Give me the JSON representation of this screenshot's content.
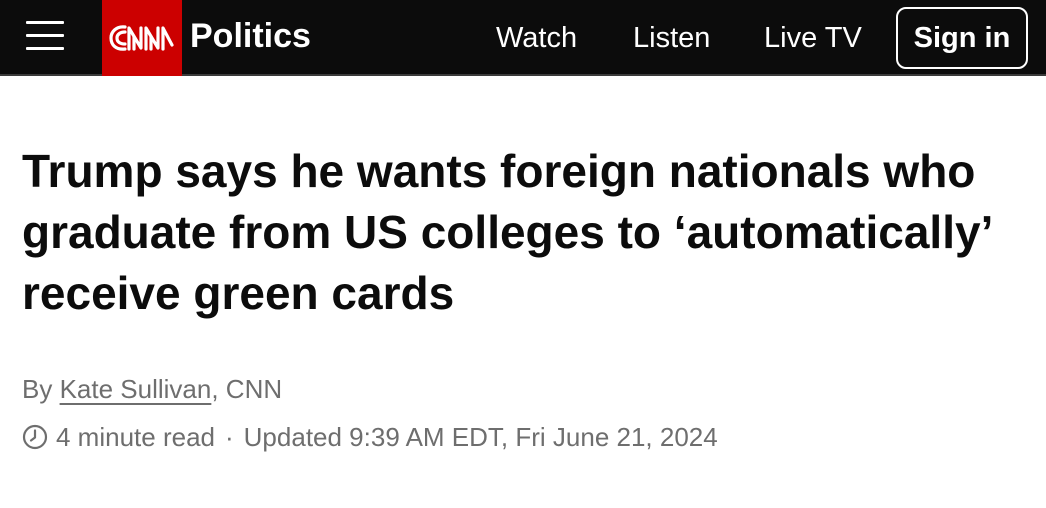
{
  "header": {
    "brand": "CNN",
    "section": "Politics",
    "nav": [
      "Watch",
      "Listen",
      "Live TV"
    ],
    "signin_label": "Sign in",
    "icons": {
      "menu": "hamburger-menu-icon",
      "logo": "cnn-logo"
    },
    "colors": {
      "bar": "#0c0c0c",
      "brand_red": "#cc0000"
    }
  },
  "article": {
    "headline": "Trump says he wants foreign nationals who graduate from US colleges to ‘automatically’ receive green cards",
    "byline_prefix": "By ",
    "author": "Kate Sullivan",
    "byline_suffix": ", CNN",
    "read_time": "4 minute read",
    "separator": "·",
    "updated": "Updated 9:39 AM EDT, Fri June 21, 2024",
    "icons": {
      "read_time": "clock-icon"
    }
  }
}
